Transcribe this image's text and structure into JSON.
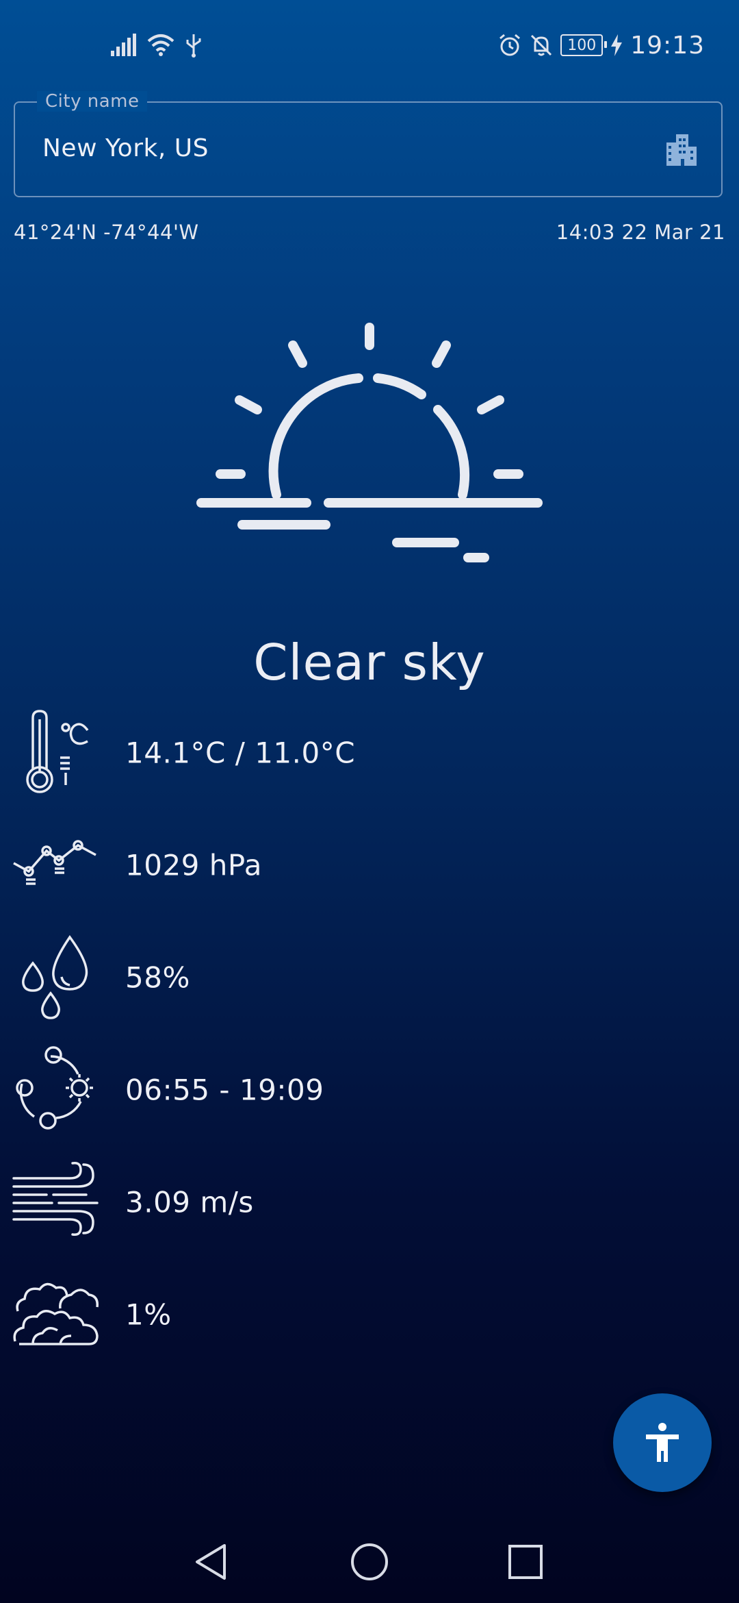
{
  "status_bar": {
    "battery": "100",
    "time": "19:13",
    "icons": [
      "signal-icon",
      "wifi-icon",
      "usb-icon",
      "alarm-icon",
      "bell-off-icon",
      "battery-icon",
      "charging-icon"
    ]
  },
  "city": {
    "label": "City name",
    "value": "New York, US",
    "icon": "city-buildings-icon"
  },
  "location": {
    "coordinates": "41°24'N -74°44'W",
    "updated": "14:03 22 Mar 21"
  },
  "weather": {
    "icon": "sunrise-clear-sky-icon",
    "condition": "Clear sky"
  },
  "metrics": [
    {
      "icon": "thermometer-icon",
      "value": "14.1°C / 11.0°C"
    },
    {
      "icon": "pressure-icon",
      "value": "1029 hPa"
    },
    {
      "icon": "humidity-drops-icon",
      "value": "58%"
    },
    {
      "icon": "sunrise-sunset-icon",
      "value": "06:55 - 19:09"
    },
    {
      "icon": "wind-icon",
      "value": "3.09 m/s"
    },
    {
      "icon": "clouds-icon",
      "value": "1%"
    }
  ],
  "fab": {
    "icon": "accessibility-icon"
  },
  "nav": {
    "icons": [
      "back-icon",
      "home-icon",
      "recents-icon"
    ]
  },
  "colors": {
    "background_top": "#004e95",
    "background_bottom": "#010420",
    "fab": "#0a5aa6",
    "text": "#eef0f6"
  }
}
